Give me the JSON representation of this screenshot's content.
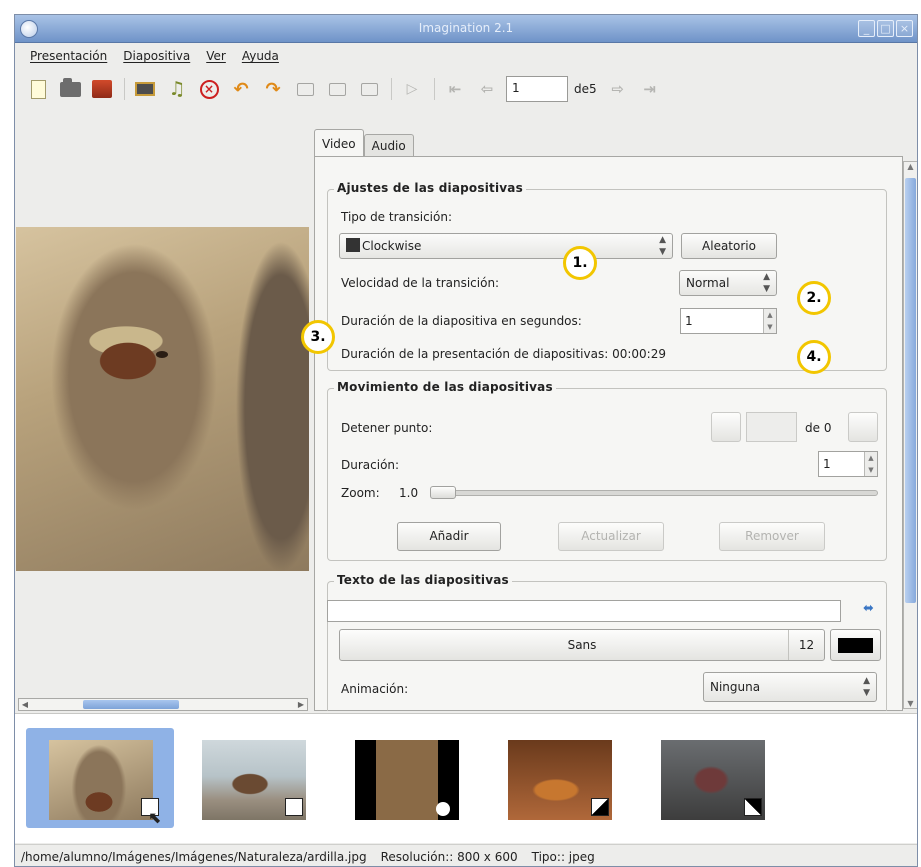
{
  "window": {
    "title": "Imagination 2.1",
    "controls": [
      "_",
      "□",
      "×"
    ]
  },
  "menu": [
    "Presentación",
    "Diapositiva",
    "Ver",
    "Ayuda"
  ],
  "toolbar": {
    "current_slide": "1",
    "of_slides": "de5"
  },
  "tabs": [
    "Video",
    "Audio"
  ],
  "slide_settings": {
    "title": "Ajustes de las diapositivas",
    "transition_type_label": "Tipo de transición:",
    "transition_value": "Clockwise",
    "random_button": "Aleatorio",
    "transition_speed_label": "Velocidad de la transición:",
    "transition_speed_value": "Normal",
    "slide_duration_label": "Duración de la diapositiva en segundos:",
    "slide_duration_value": "1",
    "presentation_duration_label": "Duración de la presentación de diapositivas: 00:00:29"
  },
  "motion": {
    "title": "Movimiento de las diapositivas",
    "stop_point_label": "Detener punto:",
    "of_zero": "de 0",
    "duration_label": "Duración:",
    "duration_value": "1",
    "zoom_label": "Zoom:",
    "zoom_value": "1.0",
    "add_button": "Añadir",
    "update_button": "Actualizar",
    "remove_button": "Remover"
  },
  "slide_text": {
    "title": "Texto de las diapositivas",
    "font_name": "Sans",
    "font_size": "12",
    "animation_label": "Animación:",
    "animation_value": "Ninguna",
    "text_color": "#000000"
  },
  "annotations": [
    "1.",
    "2.",
    "3.",
    "4."
  ],
  "status": {
    "path": "/home/alumno/Imágenes/Imágenes/Naturaleza/ardilla.jpg",
    "resolution": "Resolución:: 800 x 600",
    "type": "Tipo:: jpeg"
  },
  "accent_color": "#8fb2e6",
  "annotation_color": "#f2c600"
}
